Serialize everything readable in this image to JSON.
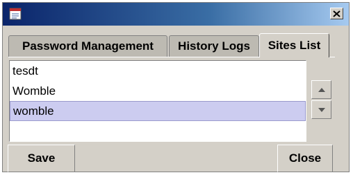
{
  "window": {
    "app_icon": "pencil-document-icon",
    "close_icon": "close-x-icon"
  },
  "tabs": [
    {
      "label": "Password Management",
      "active": false
    },
    {
      "label": "History Logs",
      "active": false
    },
    {
      "label": "Sites List",
      "active": true
    }
  ],
  "sites_list": {
    "items": [
      "tesdt",
      "Womble",
      "womble"
    ],
    "selected_index": 2
  },
  "controls": {
    "move_up_icon": "up-arrow-icon",
    "move_down_icon": "down-arrow-icon",
    "save_label": "Save",
    "close_label": "Close"
  },
  "colors": {
    "title_gradient_start": "#0a246a",
    "title_gradient_end": "#a6caf0",
    "selection": "#ccccf0",
    "window_bg": "#d4d0c8"
  }
}
